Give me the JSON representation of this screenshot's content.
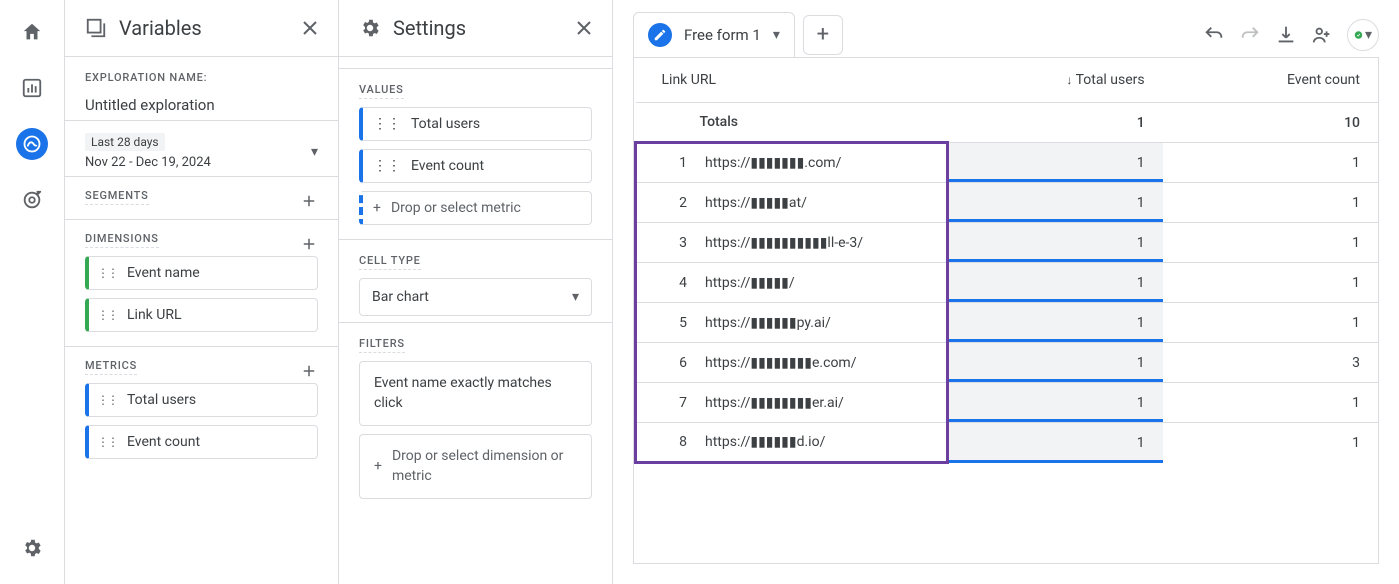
{
  "variables_title": "Variables",
  "settings_title": "Settings",
  "exploration_label": "EXPLORATION NAME:",
  "exploration_name": "Untitled exploration",
  "date_chip": "Last 28 days",
  "date_range": "Nov 22 - Dec 19, 2024",
  "segments_label": "SEGMENTS",
  "dimensions_label": "DIMENSIONS",
  "dimension_chips": [
    "Event name",
    "Link URL"
  ],
  "metrics_label": "METRICS",
  "metric_chips": [
    "Total users",
    "Event count"
  ],
  "values_label": "VALUES",
  "value_chips": [
    "Total users",
    "Event count"
  ],
  "drop_metric": "Drop or select metric",
  "cell_type_label": "CELL TYPE",
  "cell_type_value": "Bar chart",
  "filters_label": "FILTERS",
  "filter_text": "Event name exactly matches click",
  "drop_dim_metric": "Drop or select dimension or metric",
  "tab_name": "Free form 1",
  "col_link": "Link URL",
  "col_total_users": "Total users",
  "col_event_count": "Event count",
  "totals_label": "Totals",
  "totals_users": "1",
  "totals_events": "10",
  "rows": [
    {
      "n": "1",
      "url": "https://▮▮▮▮▮▮▮.com/",
      "users": "1",
      "events": "1"
    },
    {
      "n": "2",
      "url": "https://▮▮▮▮▮at/",
      "users": "1",
      "events": "1"
    },
    {
      "n": "3",
      "url": "https://▮▮▮▮▮▮▮▮▮▮ll-e-3/",
      "users": "1",
      "events": "1"
    },
    {
      "n": "4",
      "url": "https://▮▮▮▮▮/",
      "users": "1",
      "events": "1"
    },
    {
      "n": "5",
      "url": "https://▮▮▮▮▮▮py.ai/",
      "users": "1",
      "events": "1"
    },
    {
      "n": "6",
      "url": "https://▮▮▮▮▮▮▮▮e.com/",
      "users": "1",
      "events": "3"
    },
    {
      "n": "7",
      "url": "https://▮▮▮▮▮▮▮▮er.ai/",
      "users": "1",
      "events": "1"
    },
    {
      "n": "8",
      "url": "https://▮▮▮▮▮▮d.io/",
      "users": "1",
      "events": "1"
    }
  ]
}
